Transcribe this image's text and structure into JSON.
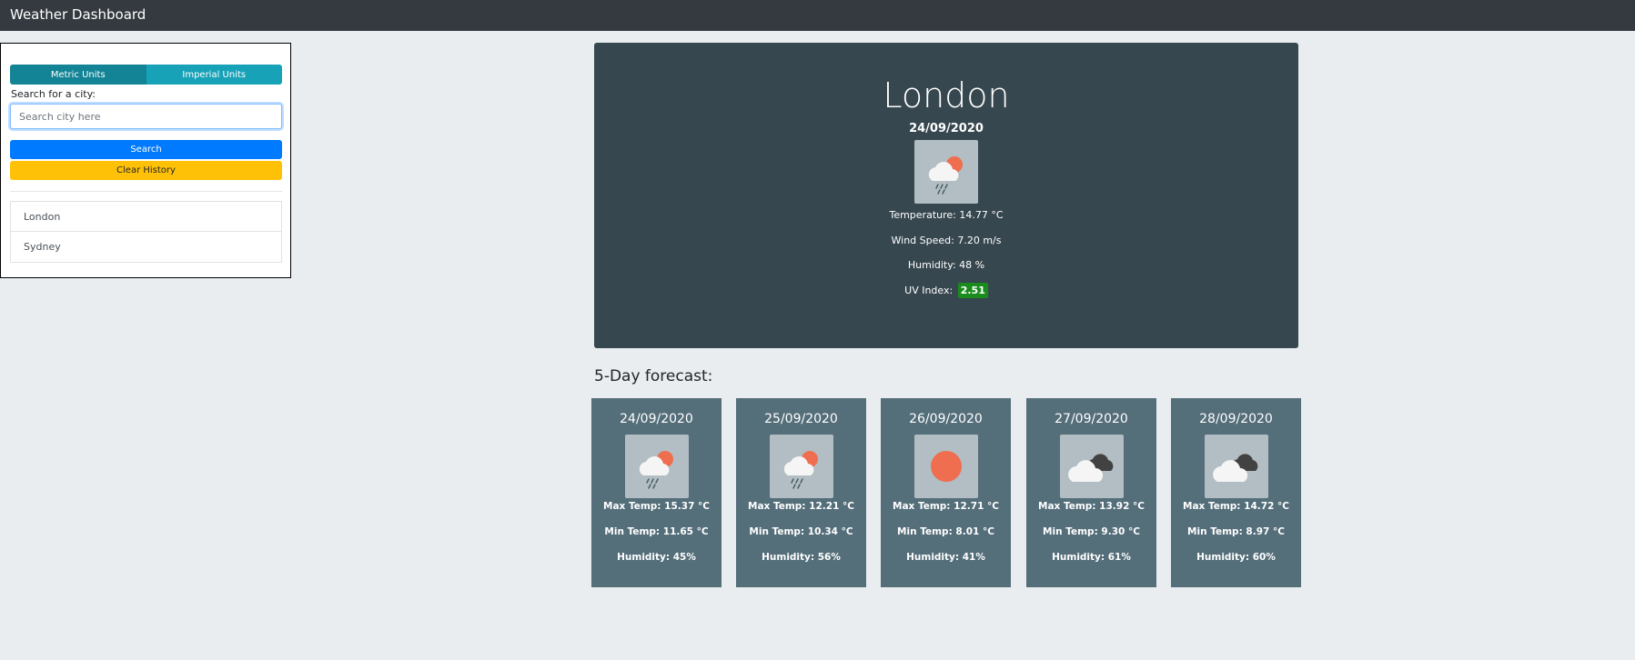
{
  "app": {
    "title": "Weather Dashboard"
  },
  "sidebar": {
    "metric_label": "Metric Units",
    "imperial_label": "Imperial Units",
    "search_label": "Search for a city:",
    "search_placeholder": "Search city here",
    "search_value": "",
    "search_button": "Search",
    "clear_button": "Clear History",
    "history": [
      "London",
      "Sydney"
    ]
  },
  "current": {
    "city": "London",
    "date": "24/09/2020",
    "icon": "rain-sun-icon",
    "temperature": "Temperature: 14.77 °C",
    "wind": "Wind Speed: 7.20 m/s",
    "humidity": "Humidity: 48 %",
    "uv_label": "UV Index:",
    "uv_value": "2.51",
    "uv_color": "#198c1d"
  },
  "forecast": {
    "title": "5-Day forecast:",
    "days": [
      {
        "date": "24/09/2020",
        "icon": "rain-sun-icon",
        "max": "Max Temp: 15.37 °C",
        "min": "Min Temp: 11.65 °C",
        "humidity": "Humidity: 45%"
      },
      {
        "date": "25/09/2020",
        "icon": "rain-sun-icon",
        "max": "Max Temp: 12.21 °C",
        "min": "Min Temp: 10.34 °C",
        "humidity": "Humidity: 56%"
      },
      {
        "date": "26/09/2020",
        "icon": "sun-icon",
        "max": "Max Temp: 12.71 °C",
        "min": "Min Temp: 8.01 °C",
        "humidity": "Humidity: 41%"
      },
      {
        "date": "27/09/2020",
        "icon": "clouds-icon",
        "max": "Max Temp: 13.92 °C",
        "min": "Min Temp: 9.30 °C",
        "humidity": "Humidity: 61%"
      },
      {
        "date": "28/09/2020",
        "icon": "clouds-icon",
        "max": "Max Temp: 14.72 °C",
        "min": "Min Temp: 8.97 °C",
        "humidity": "Humidity: 60%"
      }
    ]
  },
  "colors": {
    "navbar": "#343a40",
    "current_bg": "#37474f",
    "card_bg": "#546e7a",
    "sun": "#ee6e4f"
  }
}
